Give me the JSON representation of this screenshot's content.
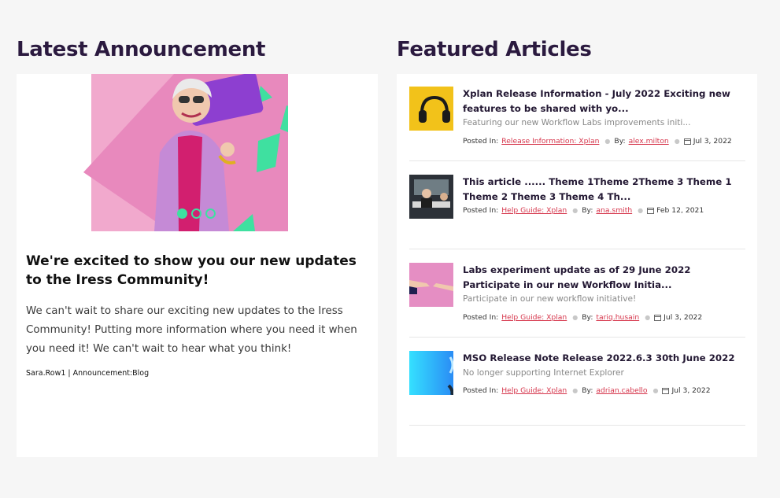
{
  "announcement": {
    "section_title": "Latest Announcement",
    "heading": "We're excited to show you our new updates to the Iress Community!",
    "body": "We can't wait to share our exciting new updates to the Iress Community! Putting more information where you need it when you need it! We can't wait to hear what you think!",
    "meta": "Sara.Row1 | Announcement:Blog",
    "carousel": {
      "slide_count": 3,
      "active_index": 0
    }
  },
  "featured": {
    "section_title": "Featured Articles",
    "posted_in_label": "Posted In:",
    "by_label": "By:",
    "articles": [
      {
        "title": "Xplan Release Information - July 2022 Exciting new features to be shared with yo...",
        "excerpt": "Featuring our new Workflow Labs improvements initi...",
        "category": "Release Information: Xplan",
        "author": "alex.milton",
        "date": "Jul 3, 2022",
        "thumb_icon": "headphones-thumbnail"
      },
      {
        "title": "This article ...... Theme 1Theme 2Theme 3 Theme 1 Theme 2 Theme 3 Theme 4 Th...",
        "excerpt": "",
        "category": "Help Guide: Xplan",
        "author": "ana.smith",
        "date": "Feb 12, 2021",
        "thumb_icon": "meeting-thumbnail"
      },
      {
        "title": "Labs experiment update as of 29 June 2022 Participate in our new Workflow Initia...",
        "excerpt": "Participate in our new workflow initiative!",
        "category": "Help Guide: Xplan",
        "author": "tariq.husain",
        "date": "Jul 3, 2022",
        "thumb_icon": "hands-thumbnail"
      },
      {
        "title": "MSO Release Note Release 2022.6.3 30th June 2022",
        "excerpt": "No longer supporting Internet Explorer",
        "category": "Help Guide: Xplan",
        "author": "adrian.cabello",
        "date": "Jul 3, 2022",
        "thumb_icon": "blue-gradient-thumbnail"
      }
    ]
  },
  "colors": {
    "title": "#2b1a3f",
    "link": "#d6364c",
    "accent": "#3fe0a0",
    "pink": "#f1a9cd"
  }
}
